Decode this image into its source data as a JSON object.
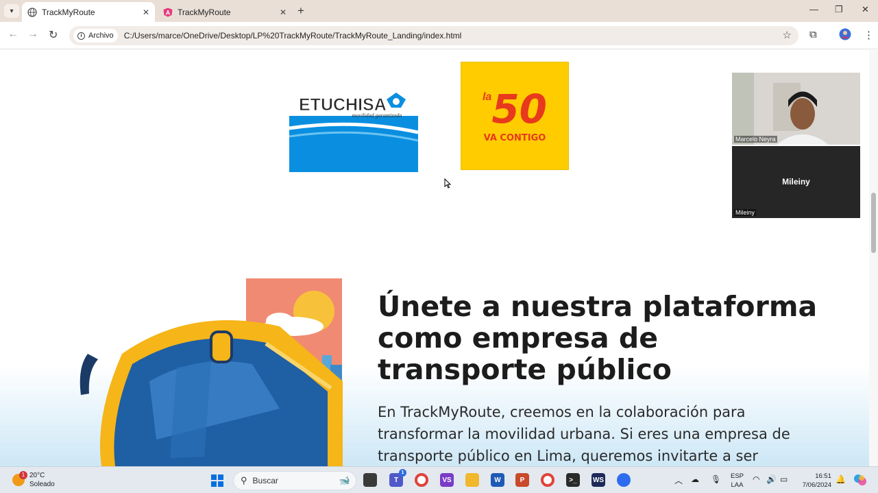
{
  "browser": {
    "tabs": [
      {
        "title": "TrackMyRoute",
        "active": true
      },
      {
        "title": "TrackMyRoute",
        "active": false
      }
    ],
    "omnibox": {
      "chip_label": "Archivo",
      "url": "C:/Users/marce/OneDrive/Desktop/LP%20TrackMyRoute/TrackMyRoute_Landing/index.html"
    }
  },
  "page": {
    "logos": [
      {
        "name": "ETUCHISA",
        "tagline": "movilidad garantizada"
      },
      {
        "name": "la 50",
        "number": "50",
        "prefix": "la",
        "tagline": "VA CONTIGO"
      }
    ],
    "headline": "Únete a nuestra plataforma como empresa de transporte público",
    "paragraph": "En TrackMyRoute, creemos en la colaboración para transformar la movilidad urbana. Si eres una empresa de transporte público en Lima, queremos invitarte a ser"
  },
  "video_call": {
    "participants": [
      {
        "name": "Marcelo Neyra",
        "video": true
      },
      {
        "name": "Mileiny",
        "video": false,
        "center_label": "Mileiny"
      }
    ]
  },
  "taskbar": {
    "weather": {
      "temp": "20°C",
      "condition": "Soleado",
      "badge": "1"
    },
    "search_placeholder": "Buscar",
    "teams_badge": "1",
    "language": {
      "line1": "ESP",
      "line2": "LAA"
    },
    "clock": {
      "time": "16:51",
      "date": "7/06/2024"
    }
  },
  "colors": {
    "tabbar": "#e9dfd7",
    "logo_50_bg": "#ffcc00",
    "logo_50_text": "#e8391d",
    "etuchisa_blue": "#0a8fe0"
  }
}
